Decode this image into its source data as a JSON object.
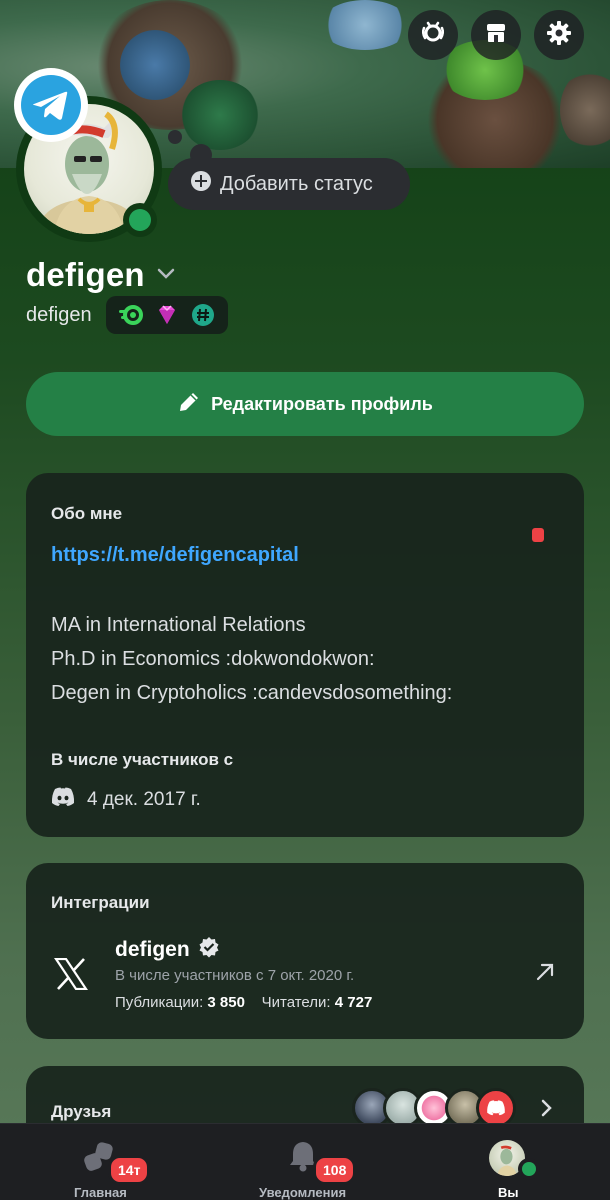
{
  "header": {
    "add_status_label": "Добавить статус"
  },
  "profile": {
    "display_name": "defigen",
    "username": "defigen",
    "edit_profile_label": "Редактировать профиль"
  },
  "about": {
    "title": "Обо мне",
    "link": "https://t.me/defigencapital",
    "bio_lines": [
      "MA in International Relations",
      "Ph.D in Economics :dokwondokwon:",
      "Degen in Cryptoholics :candevsdosomething:"
    ],
    "member_since_title": "В числе участников с",
    "member_since_date": "4 дек. 2017 г."
  },
  "integrations": {
    "title": "Интеграции",
    "account_name": "defigen",
    "since": "В числе участников с 7 окт. 2020 г.",
    "posts_label": "Публикации:",
    "posts_value": "3 850",
    "followers_label": "Читатели:",
    "followers_value": "4 727"
  },
  "friends": {
    "title": "Друзья"
  },
  "nav": {
    "home_label": "Главная",
    "home_badge": "14т",
    "notifications_label": "Уведомления",
    "notifications_badge": "108",
    "you_label": "Вы"
  },
  "colors": {
    "accent_green": "#248046",
    "online": "#23a55a",
    "link": "#3fa7ff",
    "badge_red": "#ed4245"
  }
}
